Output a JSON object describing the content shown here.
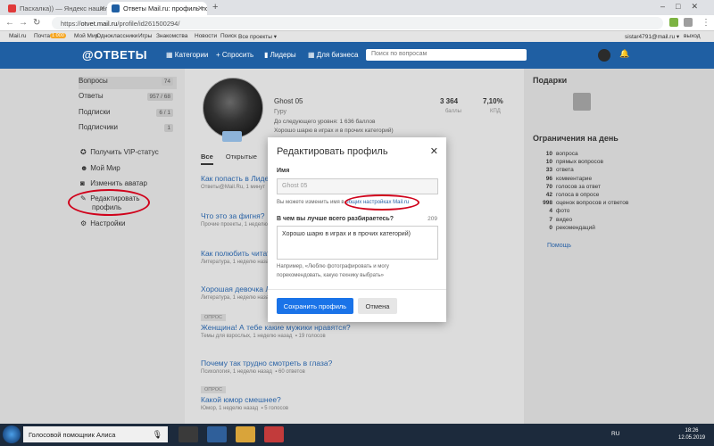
{
  "browser": {
    "tabs": [
      {
        "label": "Пасхалка)) — Яндекс нашел",
        "active": false
      },
      {
        "label": "Ответы Mail.ru: профиль польз",
        "active": true
      }
    ],
    "url_prefix": "https://",
    "url_host": "otvet.mail.ru",
    "url_path": "/profile/id261500294/"
  },
  "portal_bar": {
    "items": [
      "Mail.ru",
      "Почта",
      "Мой Мир",
      "Одноклассники",
      "Игры",
      "Знакомства",
      "Новости",
      "Поиск",
      "Все проекты ▾"
    ],
    "mail_badge": "1 000",
    "user": "sistar4791@mail.ru ▾",
    "logout": "выход"
  },
  "header": {
    "logo": "@ОТВЕТЫ",
    "nav": [
      "Категории",
      "Спросить",
      "Лидеры",
      "Для бизнеса"
    ],
    "search_placeholder": "Поиск по вопросам"
  },
  "sidebar": {
    "stats": [
      {
        "label": "Вопросы",
        "count": "74"
      },
      {
        "label": "Ответы",
        "count": "957 / 68"
      },
      {
        "label": "Подписки",
        "count": "6 / 1"
      },
      {
        "label": "Подписчики",
        "count": "1"
      }
    ],
    "links": [
      "Получить VIP-статус",
      "Мой Мир",
      "Изменить аватар",
      "Редактировать",
      "профиль",
      "Настройки"
    ]
  },
  "profile": {
    "name": "Ghost 05",
    "rank": "Гуру",
    "points_text": "До следующего уровня: 1 636 баллов",
    "about_text": "Хорошо шарю в играх и в прочих категорий)",
    "points": "3 364",
    "points_label": "баллы",
    "kpd": "7,10%",
    "kpd_label": "КПД",
    "tabs": [
      "Все",
      "Открытые"
    ]
  },
  "questions": [
    {
      "title": "Как попасть в Лидер",
      "meta": "Ответы@Mail.Ru, 1 минут"
    },
    {
      "title": "Что это за фигня?",
      "meta": "Прочие проекты, 1 неделю"
    },
    {
      "title": "Как полюбить читать",
      "meta": "Литература, 1 неделю назад"
    },
    {
      "title": "Хорошая девочка Ли",
      "meta": "Литература, 1 неделю назад"
    },
    {
      "tag": "ОПРОС",
      "title": "Женщина! А тебе какие мужики нравятся?",
      "meta": "Темы для взрослых, 1 неделю назад",
      "count": "19 голосов"
    },
    {
      "title": "Почему так трудно смотреть в глаза?",
      "meta": "Психология, 1 неделю назад",
      "count": "60 ответов"
    },
    {
      "tag": "ОПРОС",
      "title": "Какой юмор смешнее?",
      "meta": "Юмор, 1 неделю назад",
      "count": "5 голосов"
    }
  ],
  "right_panel": {
    "gifts_title": "Подарки",
    "limits_title": "Ограничения на день",
    "limits": [
      {
        "n": "10",
        "label": "вопроса"
      },
      {
        "n": "10",
        "label": "прямых вопросов"
      },
      {
        "n": "33",
        "label": "ответа"
      },
      {
        "n": "96",
        "label": "комментарие"
      },
      {
        "n": "70",
        "label": "голосов за ответ"
      },
      {
        "n": "42",
        "label": "голоса в опросе"
      },
      {
        "n": "998",
        "label": "оценок вопросов и ответов"
      },
      {
        "n": "4",
        "label": "фото"
      },
      {
        "n": "7",
        "label": "видео"
      },
      {
        "n": "0",
        "label": "рекомендаций"
      }
    ],
    "help_link": "Помощь"
  },
  "modal": {
    "title": "Редактировать профиль",
    "name_label": "Имя",
    "name_value": "Ghost 05",
    "name_hint_prefix": "Вы можете изменить имя в ",
    "name_hint_link": "общих настройках Mail.ru",
    "about_label": "В чем вы лучше всего разбираетесь?",
    "about_count": "209",
    "about_value": "Хорошо шарю в играх и в прочих категорий)",
    "about_hint_1": "Например, «Люблю фотографировать и могу",
    "about_hint_2": "порекомендовать, какую технику выбрать»",
    "save_button": "Сохранить профиль",
    "cancel_button": "Отмена"
  },
  "taskbar": {
    "alice": "Голосовой помощник Алиса",
    "lang": "RU",
    "time": "18:26",
    "date": "12.05.2019"
  },
  "colors": {
    "header": "#1f5fa3",
    "accent": "#2a63a6",
    "save_button": "#1a73e8",
    "highlight": "#d0021b"
  }
}
